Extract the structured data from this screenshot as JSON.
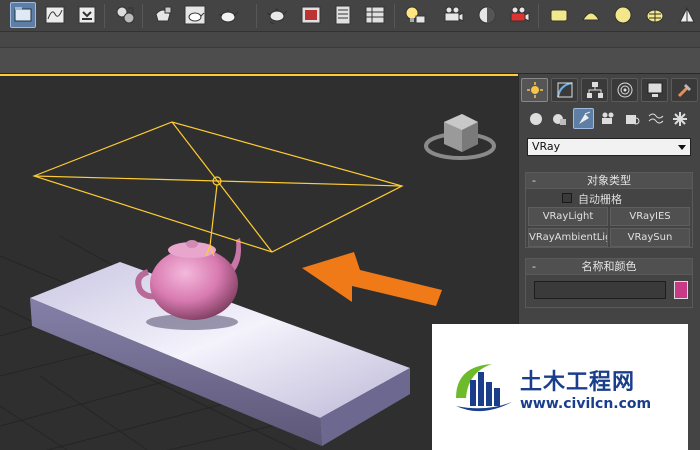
{
  "toolbar": {
    "buttons": [
      "open-file-icon",
      "curve-editor-icon",
      "render-setup-icon",
      "material-editor-icon",
      "render-frame-icon",
      "teapot-render-icon",
      "active-shade-icon",
      "teapot-icon",
      "render-frame-window-icon",
      "scene-explorer-icon",
      "layer-manager-icon",
      "light-lister-icon",
      "camera-icon",
      "exposure-icon",
      "vray-frame-buffer-icon",
      "plane-icon",
      "dome-icon",
      "sphere-icon",
      "mesh-light-icon"
    ]
  },
  "command_panel": {
    "tabs": [
      "create-tab",
      "modify-tab",
      "hierarchy-tab",
      "motion-tab",
      "display-tab",
      "utilities-tab"
    ],
    "renderer_dropdown": {
      "selected": "VRay"
    },
    "object_type": {
      "title": "对象类型",
      "toggle": "-",
      "auto_grid_label": "自动栅格",
      "auto_grid_checked": false,
      "buttons": [
        "VRayLight",
        "VRayIES",
        "VRayAmbientLight",
        "VRaySun"
      ],
      "buttons_display": [
        "VRayLight",
        "VRayIES",
        "VRayAmbientLigh",
        "VRaySun"
      ]
    },
    "name_color": {
      "title": "名称和颜色",
      "toggle": "-",
      "name_value": "",
      "color": "#c83a86"
    }
  },
  "viewport": {
    "selection_color": "#ffcc33",
    "arrow_color": "#f07a18",
    "teapot_color": "#d87ab0"
  },
  "watermark": {
    "brand": "土木工程网",
    "url": "www.civilcn.com"
  }
}
